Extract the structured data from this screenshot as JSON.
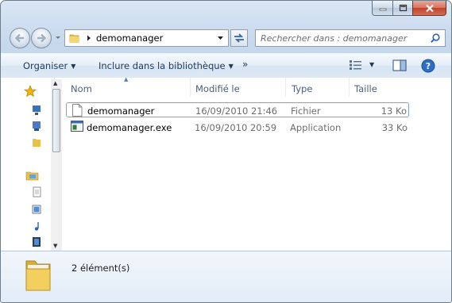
{
  "address": {
    "folder": "demomanager"
  },
  "search": {
    "placeholder": "Rechercher dans : demomanager"
  },
  "commands": {
    "organise": "Organiser",
    "include": "Inclure dans la bibliothèque",
    "more": "»"
  },
  "columns": {
    "name": "Nom",
    "modified": "Modifié le",
    "type": "Type",
    "size": "Taille"
  },
  "files": [
    {
      "name": "demomanager",
      "modified": "16/09/2010 21:46",
      "type": "Fichier",
      "size": "13 Ko",
      "icon": "blank-file-icon"
    },
    {
      "name": "demomanager.exe",
      "modified": "16/09/2010 20:59",
      "type": "Application",
      "size": "33 Ko",
      "icon": "application-icon"
    }
  ],
  "details": {
    "count": "2 élément(s)"
  },
  "icons": [
    "minimize-icon",
    "maximize-icon",
    "close-icon",
    "back-arrow-icon",
    "forward-arrow-icon",
    "folder-icon",
    "refresh-icon",
    "search-icon",
    "view-icon",
    "preview-pane-icon",
    "help-icon",
    "favorites-star-icon"
  ],
  "colors": {
    "accent": "#1e395b",
    "selection": "#7da2ce",
    "help": "#2d6fc4"
  }
}
